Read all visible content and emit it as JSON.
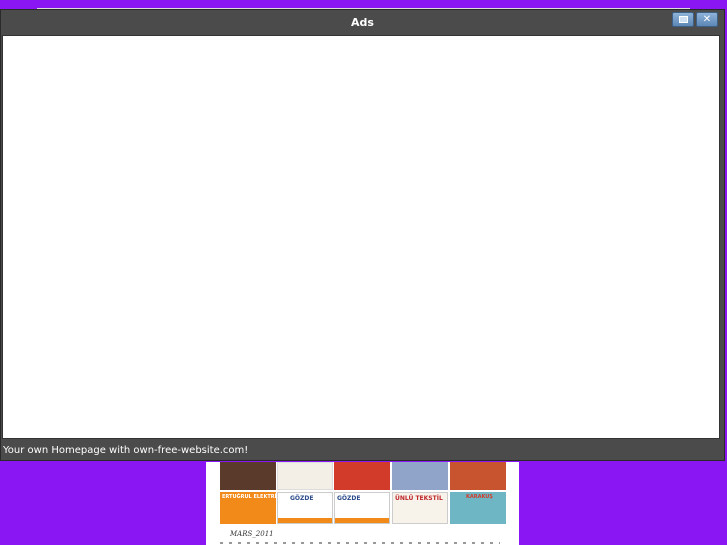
{
  "modal": {
    "title": "Ads",
    "maximize_icon": "maximize-icon",
    "close_icon": "close-icon",
    "close_glyph": "✕",
    "footer_text": "Your own Homepage with own-free-website.com!"
  },
  "background_page": {
    "colors": {
      "background": "#8a16f4",
      "accent_orange": "#f28a1a",
      "accent_red": "#d23b2a"
    },
    "ads": [
      {
        "label": "ERTUĞRUL ELEKTRİK"
      },
      {
        "label": "GÖZDE"
      },
      {
        "label": "GÖZDE"
      },
      {
        "label": "ÜNLÜ TEKSTİL"
      },
      {
        "label": "KARAKUŞ"
      }
    ],
    "stamp": "MARS_2011"
  }
}
